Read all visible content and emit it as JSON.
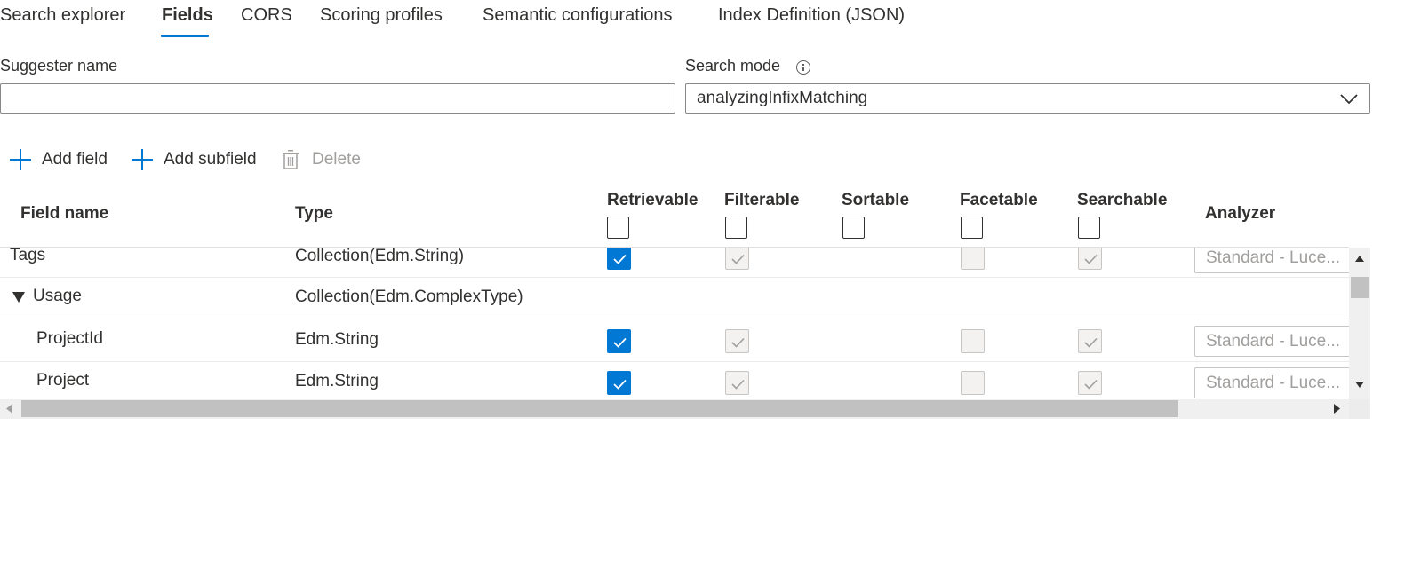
{
  "tabs": [
    {
      "label": "Search explorer",
      "active": false
    },
    {
      "label": "Fields",
      "active": true
    },
    {
      "label": "CORS",
      "active": false
    },
    {
      "label": "Scoring profiles",
      "active": false
    },
    {
      "label": "Semantic configurations",
      "active": false
    },
    {
      "label": "Index Definition (JSON)",
      "active": false
    }
  ],
  "form": {
    "suggester_label": "Suggester name",
    "suggester_value": "",
    "search_mode_label": "Search mode",
    "search_mode_value": "analyzingInfixMatching"
  },
  "toolbar": {
    "add_field": "Add field",
    "add_subfield": "Add subfield",
    "delete": "Delete"
  },
  "grid": {
    "columns": {
      "field_name": "Field name",
      "type": "Type",
      "retrievable": "Retrievable",
      "filterable": "Filterable",
      "sortable": "Sortable",
      "facetable": "Facetable",
      "searchable": "Searchable",
      "analyzer": "Analyzer"
    },
    "rows": [
      {
        "name": "Tags",
        "type": "Collection(Edm.String)",
        "retrievable": true,
        "filterable": true,
        "sortable": null,
        "facetable": false,
        "searchable": true,
        "analyzer": "Standard - Luce..."
      },
      {
        "name": "Usage",
        "type": "Collection(Edm.ComplexType)",
        "expanded": true
      },
      {
        "name": "ProjectId",
        "type": "Edm.String",
        "retrievable": true,
        "filterable": true,
        "sortable": null,
        "facetable": false,
        "searchable": true,
        "analyzer": "Standard - Luce..."
      },
      {
        "name": "Project",
        "type": "Edm.String",
        "retrievable": true,
        "filterable": true,
        "sortable": null,
        "facetable": false,
        "searchable": true,
        "analyzer": "Standard - Luce..."
      }
    ]
  },
  "colors": {
    "accent": "#0078d4",
    "disabled_text": "#a19f9d",
    "text": "#323130"
  }
}
